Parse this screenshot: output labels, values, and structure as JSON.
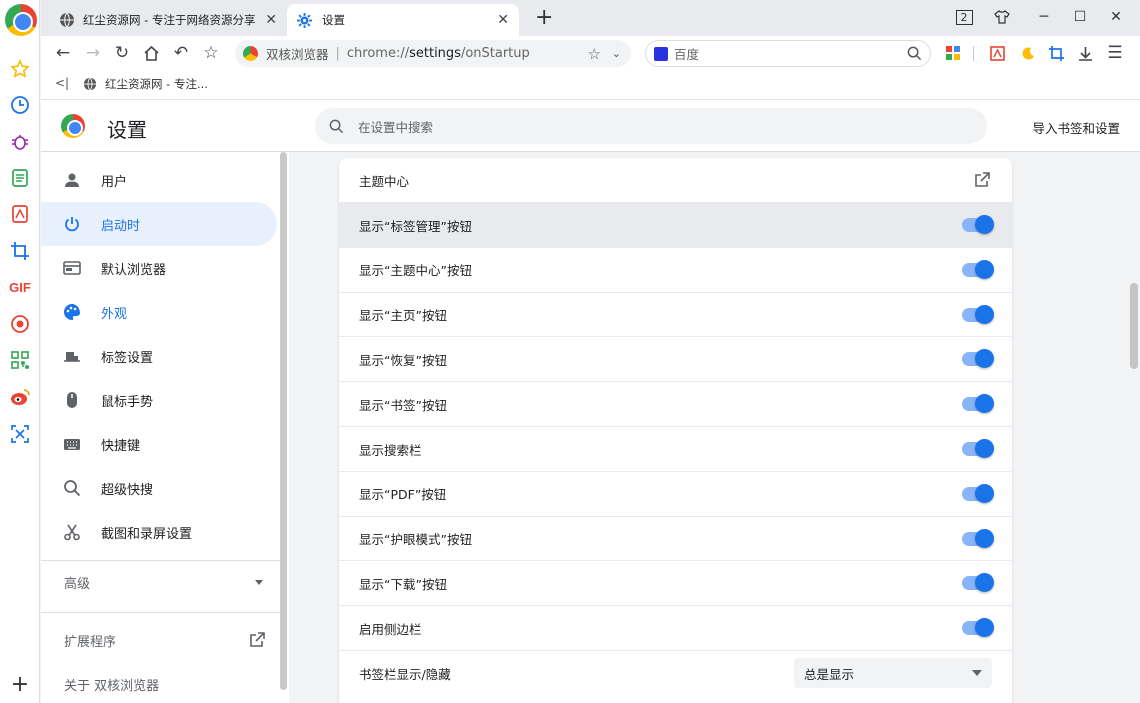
{
  "tabs": [
    {
      "title": "红尘资源网 - 专注于网络资源分享",
      "active": false
    },
    {
      "title": "设置",
      "active": true
    }
  ],
  "window": {
    "badge": "2"
  },
  "address": {
    "brand": "双核浏览器",
    "url_prefix": "chrome://",
    "url_host": "settings",
    "url_path": "/onStartup"
  },
  "search": {
    "placeholder": "百度"
  },
  "bookmarks": [
    {
      "title": "红尘资源网 - 专注..."
    }
  ],
  "settings": {
    "title": "设置",
    "search_placeholder": "在设置中搜索",
    "import_label": "导入书签和设置"
  },
  "nav": {
    "items": [
      {
        "label": "用户",
        "icon": "person-icon"
      },
      {
        "label": "启动时",
        "icon": "power-icon"
      },
      {
        "label": "默认浏览器",
        "icon": "browser-icon"
      },
      {
        "label": "外观",
        "icon": "palette-icon"
      },
      {
        "label": "标签设置",
        "icon": "tab-icon"
      },
      {
        "label": "鼠标手势",
        "icon": "mouse-icon"
      },
      {
        "label": "快捷键",
        "icon": "keyboard-icon"
      },
      {
        "label": "超级快搜",
        "icon": "search-icon"
      },
      {
        "label": "截图和录屏设置",
        "icon": "scissors-icon"
      }
    ],
    "advanced": "高级",
    "extensions": "扩展程序",
    "about": "关于 双核浏览器"
  },
  "appearance": {
    "theme_center": "主题中心",
    "rows": [
      {
        "label": "显示“标签管理”按钮",
        "on": true
      },
      {
        "label": "显示“主题中心”按钮",
        "on": true
      },
      {
        "label": "显示“主页”按钮",
        "on": true
      },
      {
        "label": "显示“恢复”按钮",
        "on": true
      },
      {
        "label": "显示“书签”按钮",
        "on": true
      },
      {
        "label": "显示搜索栏",
        "on": true
      },
      {
        "label": "显示“PDF”按钮",
        "on": true
      },
      {
        "label": "显示“护眼模式”按钮",
        "on": true
      },
      {
        "label": "显示“下载”按钮",
        "on": true
      },
      {
        "label": "启用侧边栏",
        "on": true
      }
    ],
    "bookmark_bar_label": "书签栏显示/隐藏",
    "bookmark_bar_value": "总是显示"
  },
  "colors": {
    "accent": "#1a73e8",
    "selected_nav_bg": "#e8f0fe"
  }
}
